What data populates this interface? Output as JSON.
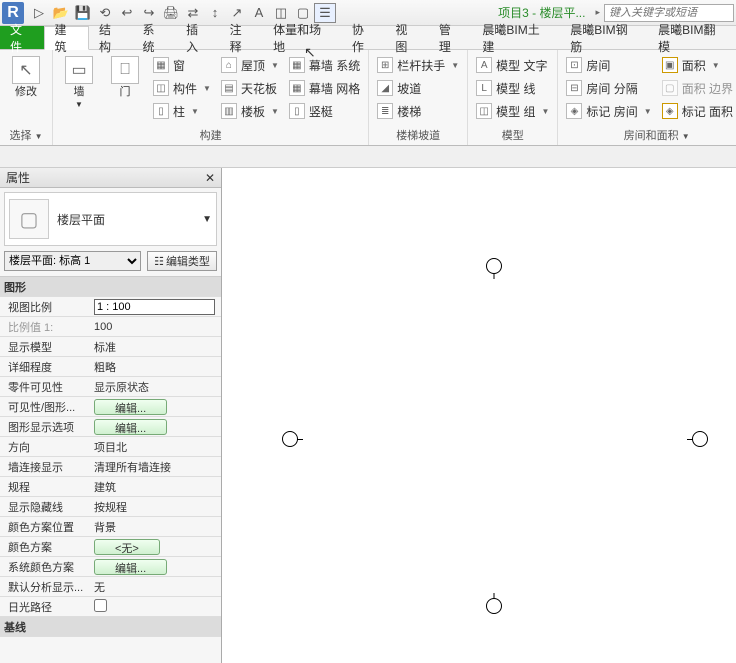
{
  "qat": {
    "doctitle": "项目3 - 楼层平...",
    "search_placeholder": "键入关键字或短语",
    "icons": [
      "↻",
      "📂",
      "💾",
      "⟲",
      "↩",
      "↪",
      "🖨",
      "⇄",
      "↕",
      "↗",
      "A",
      "◫",
      "▢",
      "☰"
    ]
  },
  "menu": {
    "file": "文件",
    "tabs": [
      "建筑",
      "结构",
      "系统",
      "插入",
      "注释",
      "体量和场地",
      "协作",
      "视图",
      "管理",
      "晨曦BIM土建",
      "晨曦BIM钢筋",
      "晨曦BIM翻模"
    ],
    "active": "建筑"
  },
  "ribbon": {
    "modify": "修改",
    "select_label": "选择",
    "wall": "墙",
    "door": "门",
    "window": "窗",
    "component": "构件",
    "column": "柱",
    "roof": "屋顶",
    "ceiling": "天花板",
    "floor": "楼板",
    "curtain_sys": "幕墙 系统",
    "curtain_grid": "幕墙 网格",
    "mullion": "竖梃",
    "build_label": "构建",
    "railing": "栏杆扶手",
    "ramp": "坡道",
    "stair": "楼梯",
    "stair_label": "楼梯坡道",
    "model_text": "模型 文字",
    "model_line": "模型 线",
    "model_group": "模型 组",
    "model_label": "模型",
    "room": "房间",
    "room_sep": "房间 分隔",
    "tag_room": "标记 房间",
    "area": "面积",
    "area_bound": "面积 边界",
    "tag_area": "标记 面积",
    "room_area_label": "房间和面积"
  },
  "selrow": {
    "label": "选择"
  },
  "props": {
    "title": "属性",
    "type_name": "楼层平面",
    "instance_sel": "楼层平面: 标高 1",
    "edit_type": "编辑类型",
    "sections": {
      "graphics": "图形",
      "underlay": "基线"
    },
    "rows": [
      {
        "k": "视图比例",
        "v": "1 : 100",
        "input": true
      },
      {
        "k": "比例值 1:",
        "v": "100",
        "dim": true
      },
      {
        "k": "显示模型",
        "v": "标准"
      },
      {
        "k": "详细程度",
        "v": "粗略"
      },
      {
        "k": "零件可见性",
        "v": "显示原状态"
      },
      {
        "k": "可见性/图形...",
        "v": "编辑...",
        "btn": true
      },
      {
        "k": "图形显示选项",
        "v": "编辑...",
        "btn": true
      },
      {
        "k": "方向",
        "v": "项目北"
      },
      {
        "k": "墙连接显示",
        "v": "清理所有墙连接"
      },
      {
        "k": "规程",
        "v": "建筑"
      },
      {
        "k": "显示隐藏线",
        "v": "按规程"
      },
      {
        "k": "颜色方案位置",
        "v": "背景"
      },
      {
        "k": "颜色方案",
        "v": "<无>",
        "btn": true
      },
      {
        "k": "系统颜色方案",
        "v": "编辑...",
        "btn": true
      },
      {
        "k": "默认分析显示...",
        "v": "无"
      },
      {
        "k": "日光路径",
        "v": "",
        "check": true
      }
    ]
  }
}
